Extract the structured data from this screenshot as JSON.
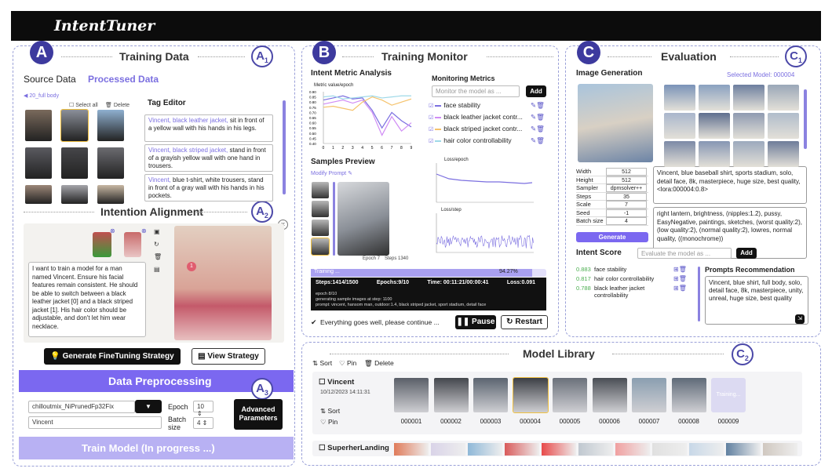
{
  "app": {
    "title": "IntentTuner"
  },
  "badges": {
    "a": "A",
    "a1": "A",
    "a2": "A",
    "a3": "A",
    "b": "B",
    "c": "C",
    "c1": "C",
    "c2": "C",
    "s1": "1",
    "s2": "2",
    "s3": "3"
  },
  "training_data": {
    "title": "Training Data",
    "tab_source": "Source Data",
    "tab_processed": "Processed Data",
    "folder": "20_full body",
    "select_all": "Select all",
    "delete": "Delete",
    "tag_editor": "Tag Editor",
    "tags": [
      {
        "hl": "Vincent, black leather jacket,",
        "rest": " sit in front of a yellow wall with his hands in his legs."
      },
      {
        "hl": "Vincent, black striped jacket,",
        "rest": " stand in front of a grayish yellow wall with one hand in trousers."
      },
      {
        "hl": "Vincent,",
        "rest": " blue t-shirt, white trousers, stand in front of a gray wall with his hands in his pockets."
      }
    ]
  },
  "intention": {
    "title": "Intention Alignment",
    "prompt": "I want to train a model for a man named Vincent. Ensure his facial features remain consistent. He should be able to switch between a black leather jacket [0] and a black striped jacket [1]. His hair color should be adjustable, and don't let him wear necklace.",
    "gen_btn": "Generate FineTuning Strategy",
    "view_btn": "View Strategy",
    "marker": "1"
  },
  "preprocess": {
    "title": "Data Preprocessing",
    "model": "chilloutmix_NiPrunedFp32Fix",
    "name": "Vincent",
    "epoch_label": "Epoch",
    "epoch": "10",
    "batch_label": "Batch size",
    "batch": "4",
    "adv": "Advanced Parameters",
    "train": "Train Model (In progress ...)"
  },
  "monitor": {
    "title": "Training Monitor",
    "ima": "Intent Metric Analysis",
    "ylabel": "Metric value/epoch",
    "mm": "Monitoring Metrics",
    "mm_placeholder": "Monitor the model as ...",
    "add": "Add",
    "metrics": [
      "face stability",
      "black leather jacket contr...",
      "black striped jacket contr...",
      "hair color controllability"
    ],
    "samples": "Samples Preview",
    "modify": "Modify Prompt",
    "epoch_cap": "Epoch 7",
    "steps_cap": "Steps 1340",
    "loss_epoch": "Loss/epoch",
    "loss_step": "Loss/step",
    "training": "Training ...",
    "pct": "94.27%",
    "stats": {
      "steps": "Steps:1414/1500",
      "epochs": "Epochs:9/10",
      "time": "Time: 00:11:21/00:00:41",
      "loss": "Loss:0.091"
    },
    "log": [
      "epoch 8/10",
      "generating sample images at step: 1100",
      "prompt: vincent, hansom man, outdoor:1.4, black striped jacket, sport stadium, detail face"
    ],
    "status": "Everything goes well, please continue ...",
    "pause": "Pause",
    "restart": "Restart"
  },
  "evaluation": {
    "title": "Evaluation",
    "img_gen": "Image Generation",
    "selected": "Selected Model: 000004",
    "params": [
      [
        "Width",
        "512"
      ],
      [
        "Height",
        "512"
      ],
      [
        "Sampler",
        "dpmsolver++"
      ],
      [
        "Steps",
        "35"
      ],
      [
        "Scale",
        "7"
      ],
      [
        "Seed",
        "-1"
      ],
      [
        "Batch size",
        "4"
      ]
    ],
    "prompt": "Vincent, blue baseball shirt, sports stadium, solo, detail face, 8k, masterpiece, huge size, best quality, <lora:000004:0.8>",
    "neg": "right lantern, brightness, (nipples:1.2), pussy, EasyNegative, paintings, sketches, (worst quality:2), (low quality:2), (normal quality:2), lowres, normal quality, ((monochrome))",
    "generate": "Generate",
    "intent_score": "Intent Score",
    "is_placeholder": "Evaluate the model as ...",
    "add": "Add",
    "scores": [
      [
        "0.883",
        "face stability"
      ],
      [
        "0.817",
        "hair color controllability"
      ],
      [
        "0.788",
        "black leather jacket controllability"
      ]
    ],
    "rec_title": "Prompts Recommendation",
    "rec": "Vincent, blue shirt, full body, solo, detail face, 8k, masterpiece, unity, unreal, huge size, best quality"
  },
  "library": {
    "title": "Model Library",
    "sort": "Sort",
    "pin": "Pin",
    "delete": "Delete",
    "model": "Vincent",
    "date": "10/12/2023 14:11:31",
    "ids": [
      "000001",
      "000002",
      "000003",
      "000004",
      "000005",
      "000006",
      "000007",
      "000008",
      "000009"
    ],
    "training": "Training...",
    "model2": "SuperherLanding"
  },
  "chart_data": {
    "type": "line",
    "title": "",
    "ylabel": "Metric value/epoch",
    "x": [
      0,
      1,
      2,
      3,
      4,
      5,
      6,
      7,
      8,
      9
    ],
    "ylim": [
      0.4,
      0.9
    ],
    "series": [
      {
        "values": [
          0.82,
          0.84,
          0.86,
          0.83,
          0.84,
          0.72,
          0.55,
          0.7,
          0.62,
          0.56
        ]
      },
      {
        "values": [
          0.78,
          0.8,
          0.82,
          0.79,
          0.82,
          0.7,
          0.48,
          0.66,
          0.52,
          0.6
        ]
      },
      {
        "values": [
          0.75,
          0.76,
          0.74,
          0.72,
          0.8,
          0.85,
          0.82,
          0.77,
          0.8,
          0.83
        ]
      },
      {
        "values": [
          0.85,
          0.86,
          0.83,
          0.84,
          0.85,
          0.86,
          0.84,
          0.85,
          0.86,
          0.86
        ]
      }
    ],
    "colors": [
      "#7b6fe0",
      "#d08cf5",
      "#f5c26b",
      "#9fd9e8"
    ]
  }
}
